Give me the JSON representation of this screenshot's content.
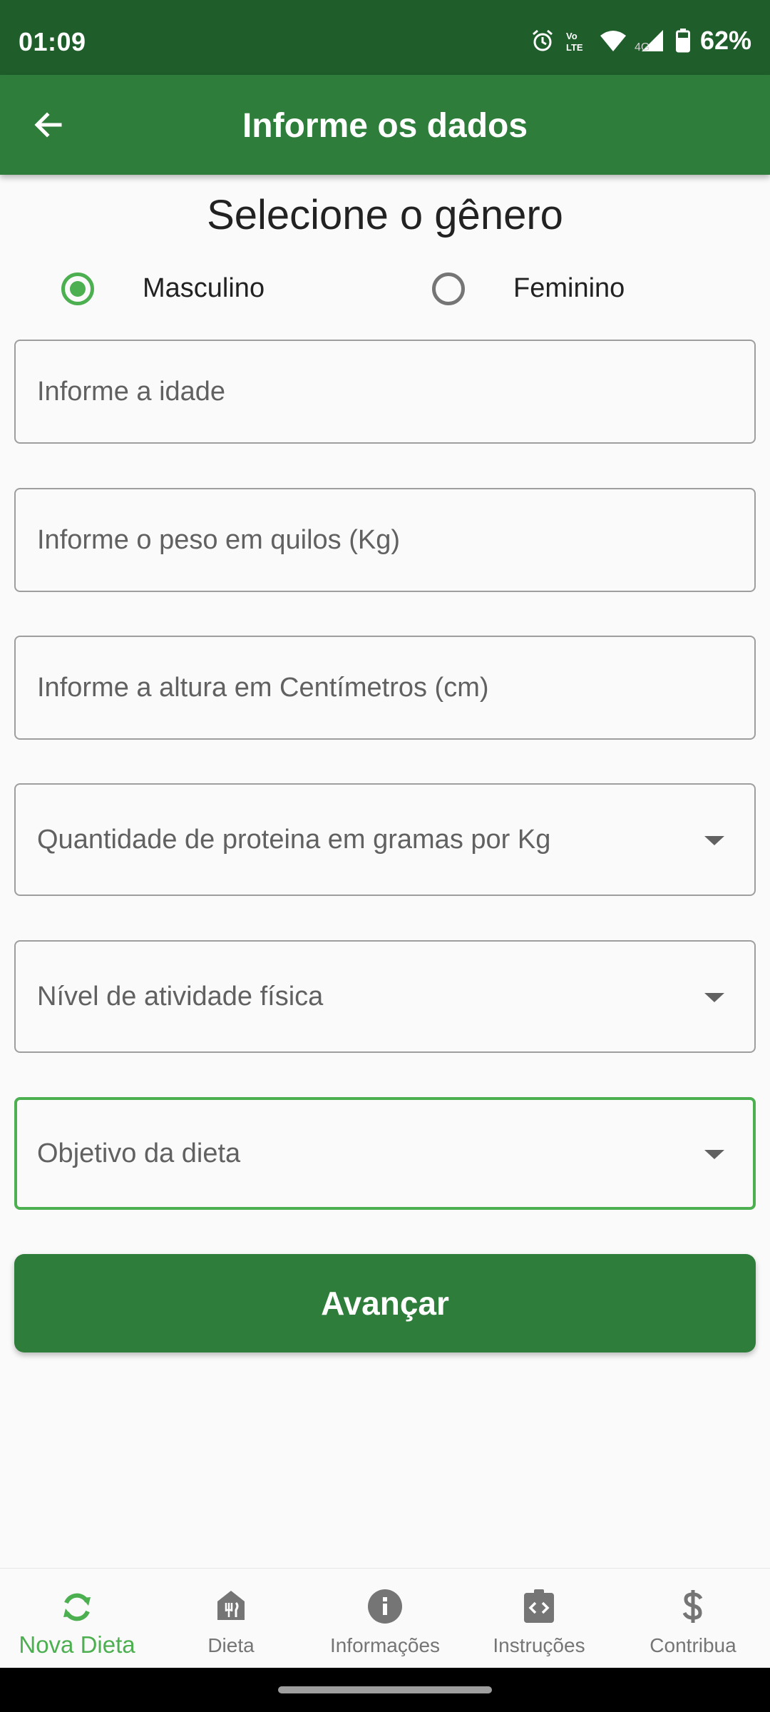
{
  "status_bar": {
    "time": "01:09",
    "battery": "62%",
    "network_label": "4G",
    "icons": [
      "alarm-icon",
      "volte-icon",
      "wifi-icon",
      "signal-icon",
      "battery-icon"
    ]
  },
  "app_bar": {
    "title": "Informe os dados",
    "back_icon": "arrow-back-icon"
  },
  "form": {
    "gender_title": "Selecione o gênero",
    "gender_options": [
      {
        "label": "Masculino",
        "selected": true
      },
      {
        "label": "Feminino",
        "selected": false
      }
    ],
    "fields": [
      {
        "placeholder": "Informe a idade",
        "value": "",
        "type": "text"
      },
      {
        "placeholder": "Informe o peso em quilos (Kg)",
        "value": "",
        "type": "text"
      },
      {
        "placeholder": "Informe a altura em Centímetros (cm)",
        "value": "",
        "type": "text"
      },
      {
        "placeholder": "Quantidade de proteina em gramas por Kg",
        "value": "",
        "type": "dropdown"
      },
      {
        "placeholder": "Nível de atividade física",
        "value": "",
        "type": "dropdown"
      },
      {
        "placeholder": "Objetivo da dieta",
        "value": "",
        "type": "dropdown",
        "focused": true
      }
    ],
    "submit_label": "Avançar"
  },
  "bottom_nav": {
    "items": [
      {
        "label": "Nova Dieta",
        "icon": "refresh-icon",
        "active": true
      },
      {
        "label": "Dieta",
        "icon": "restaurant-icon",
        "active": false
      },
      {
        "label": "Informações",
        "icon": "info-icon",
        "active": false
      },
      {
        "label": "Instruções",
        "icon": "code-clipboard-icon",
        "active": false
      },
      {
        "label": "Contribua",
        "icon": "dollar-icon",
        "active": false
      }
    ]
  },
  "colors": {
    "status_bar": "#1f5e2b",
    "primary": "#2e7d3a",
    "accent": "#4caf50",
    "inactive": "#757575"
  }
}
